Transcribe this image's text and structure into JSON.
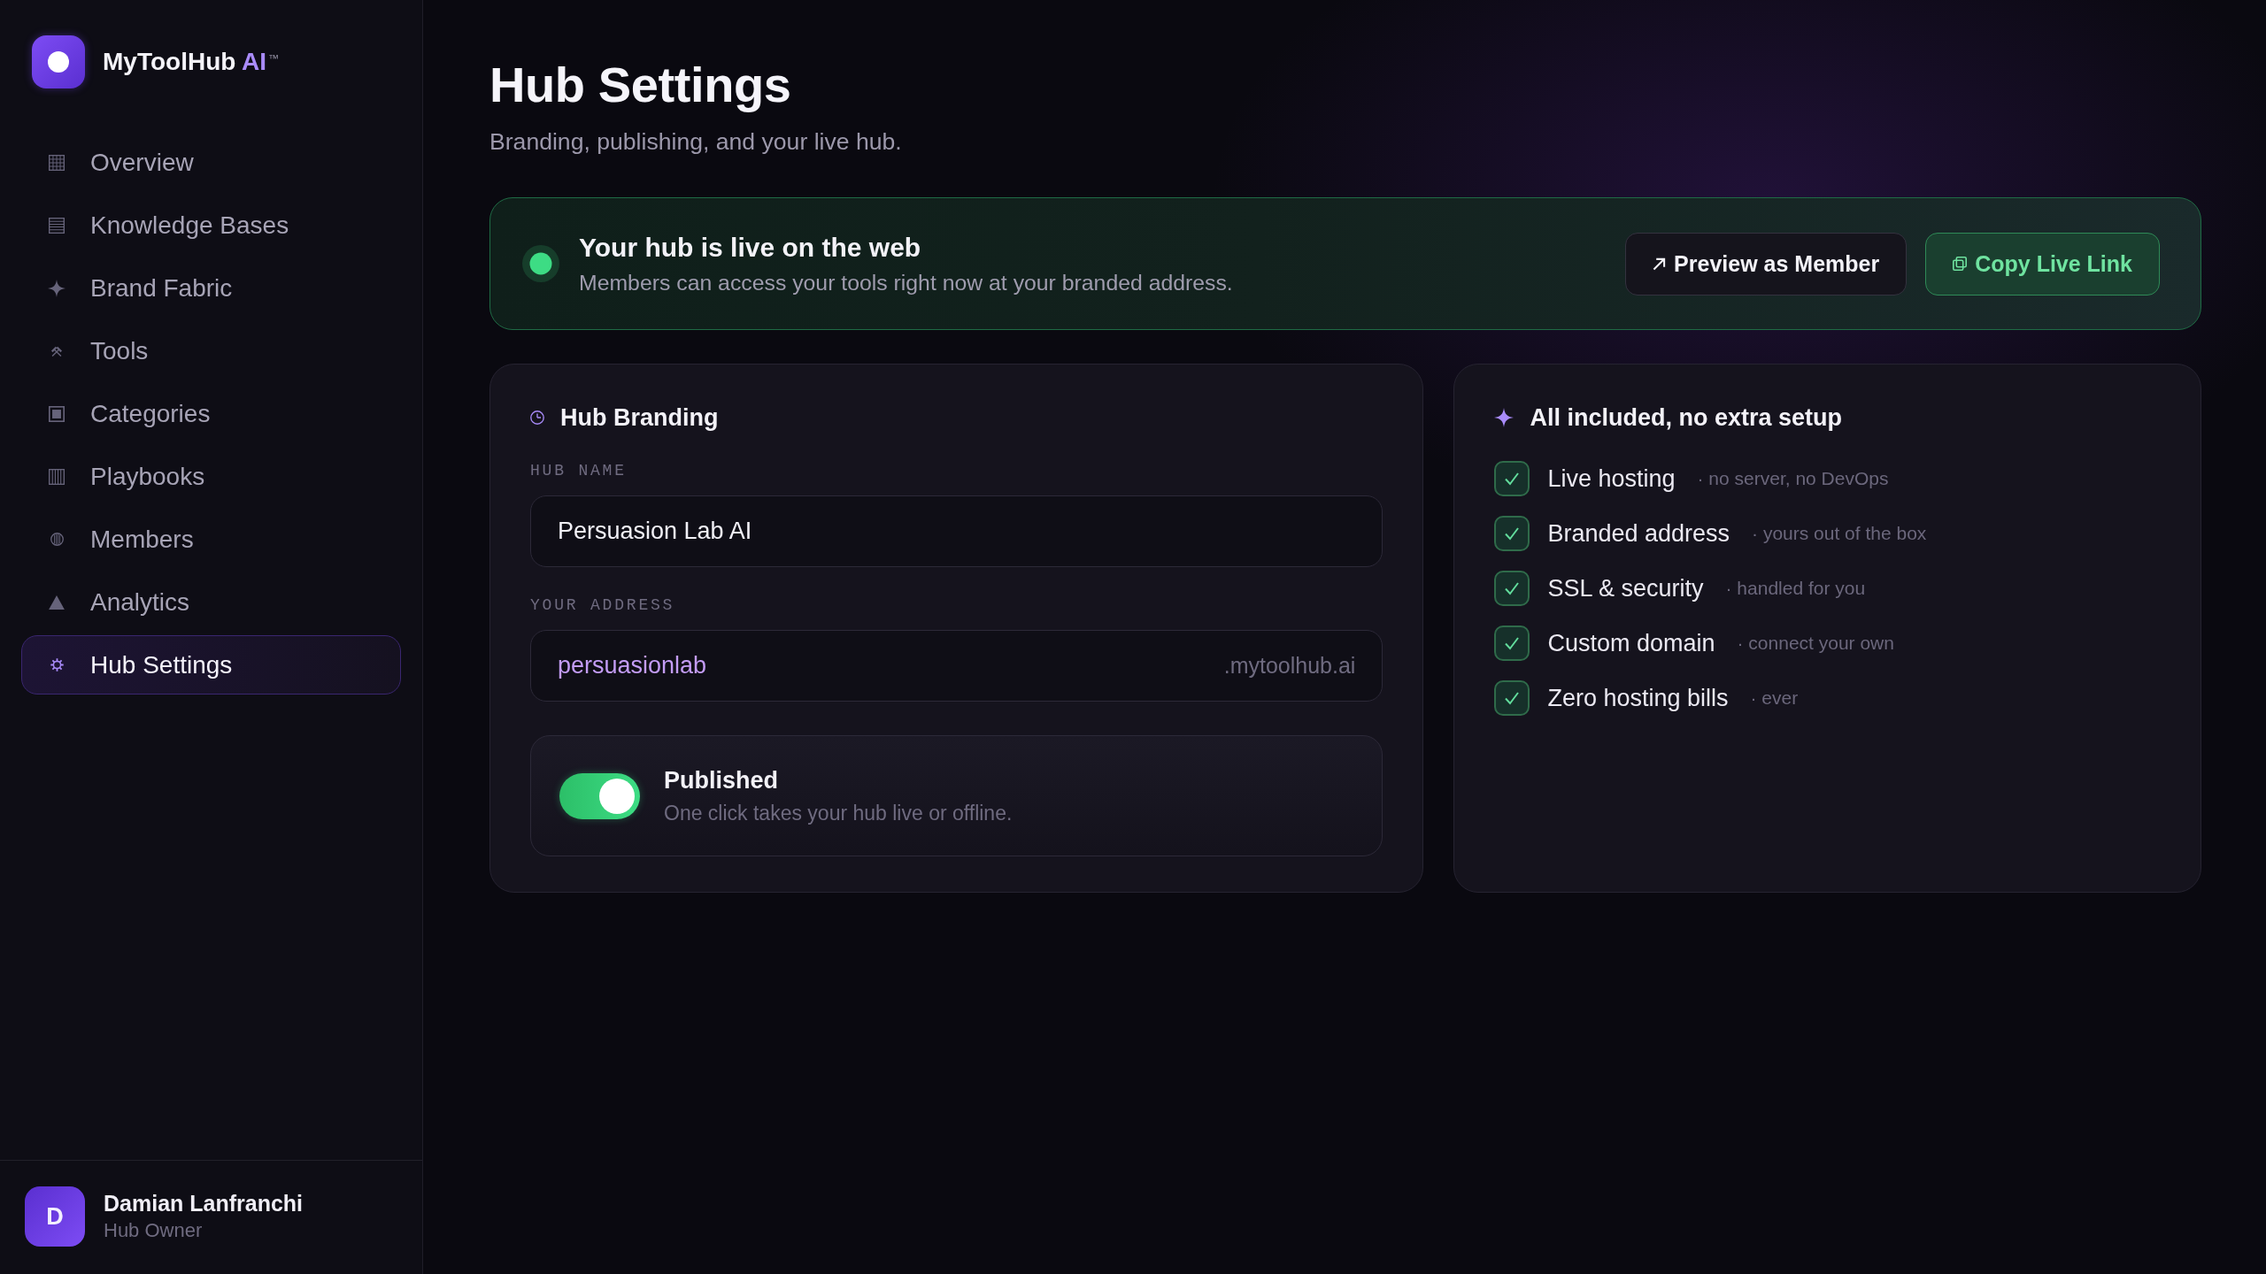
{
  "sidebar": {
    "brand": {
      "name": "MyToolHub",
      "accent": "AI",
      "trademark": "™"
    },
    "nav": [
      {
        "label": "Overview",
        "selected": false
      },
      {
        "label": "Knowledge Bases",
        "selected": false
      },
      {
        "label": "Brand Fabric",
        "selected": false
      },
      {
        "label": "Tools",
        "selected": false
      },
      {
        "label": "Categories",
        "selected": false
      },
      {
        "label": "Playbooks",
        "selected": false
      },
      {
        "label": "Members",
        "selected": false
      },
      {
        "label": "Analytics",
        "selected": false
      },
      {
        "label": "Hub Settings",
        "selected": true
      }
    ],
    "user": {
      "initial": "D",
      "name": "Damian Lanfranchi",
      "role": "Hub Owner"
    }
  },
  "header": {
    "title": "Hub Settings",
    "subtitle": "Branding, publishing, and your live hub."
  },
  "status_banner": {
    "live": true,
    "title": "Your hub is live on the web",
    "description": "Members can access your tools right now at your branded address.",
    "buttons": [
      {
        "kind": "secondary",
        "label": "Preview as Member"
      },
      {
        "kind": "primary",
        "label": "Copy Live Link"
      }
    ]
  },
  "branding_card": {
    "title": "Hub Branding",
    "fields": [
      {
        "kind": "text",
        "label": "HUB NAME",
        "value": "Persuasion Lab AI"
      },
      {
        "kind": "address",
        "label": "YOUR ADDRESS",
        "value": "persuasionlab",
        "suffix": ".mytoolhub.ai"
      }
    ],
    "publish": {
      "on": true,
      "title": "Published",
      "description": "One click takes your hub live or offline."
    }
  },
  "included_card": {
    "title": "All included, no extra setup",
    "items": [
      {
        "label": "Live hosting",
        "note": "· no server, no DevOps",
        "checked": true
      },
      {
        "label": "Branded address",
        "note": "· yours out of the box",
        "checked": true
      },
      {
        "label": "SSL & security",
        "note": "· handled for you",
        "checked": true
      },
      {
        "label": "Custom domain",
        "note": "· connect your own",
        "checked": true
      },
      {
        "label": "Zero hosting bills",
        "note": "· ever",
        "checked": true
      }
    ]
  }
}
